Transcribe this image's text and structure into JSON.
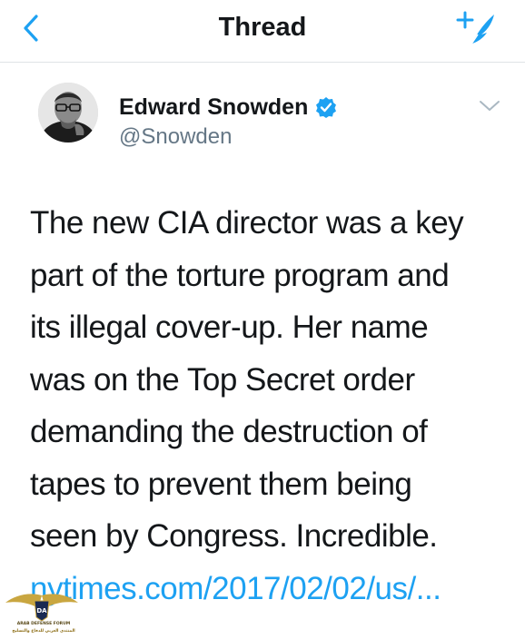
{
  "nav": {
    "title": "Thread",
    "back_icon": "chevron-left-icon",
    "compose_icon": "compose-tweet-icon",
    "accent": "#1da1f2"
  },
  "tweet": {
    "author_name": "Edward Snowden",
    "handle": "@Snowden",
    "verified": true,
    "lines": [
      "The new CIA director was a key",
      "part of the torture program and",
      "its illegal cover-up. Her name",
      "was on the Top Secret order",
      "demanding the destruction of",
      "tapes to prevent them being",
      "seen by Congress. Incredible."
    ],
    "link": "nytimes.com/2017/02/02/us/..."
  },
  "watermark": {
    "line1": "ARAB DEFENSE FORUM",
    "line2": "المنتدى العربي للدفاع والتسليح"
  }
}
